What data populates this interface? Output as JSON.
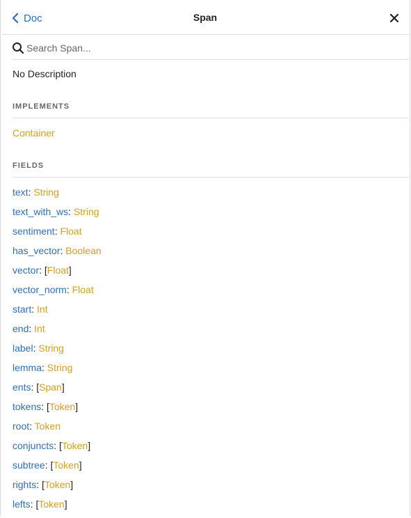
{
  "header": {
    "back_label": "Doc",
    "title": "Span"
  },
  "search": {
    "placeholder": "Search Span..."
  },
  "description": "No Description",
  "implements": {
    "heading": "IMPLEMENTS",
    "items": [
      "Container"
    ]
  },
  "fields": {
    "heading": "FIELDS",
    "items": [
      {
        "name": "text",
        "type": "String",
        "list": false
      },
      {
        "name": "text_with_ws",
        "type": "String",
        "list": false
      },
      {
        "name": "sentiment",
        "type": "Float",
        "list": false
      },
      {
        "name": "has_vector",
        "type": "Boolean",
        "list": false
      },
      {
        "name": "vector",
        "type": "Float",
        "list": true
      },
      {
        "name": "vector_norm",
        "type": "Float",
        "list": false
      },
      {
        "name": "start",
        "type": "Int",
        "list": false
      },
      {
        "name": "end",
        "type": "Int",
        "list": false
      },
      {
        "name": "label",
        "type": "String",
        "list": false
      },
      {
        "name": "lemma",
        "type": "String",
        "list": false
      },
      {
        "name": "ents",
        "type": "Span",
        "list": true
      },
      {
        "name": "tokens",
        "type": "Token",
        "list": true
      },
      {
        "name": "root",
        "type": "Token",
        "list": false
      },
      {
        "name": "conjuncts",
        "type": "Token",
        "list": true
      },
      {
        "name": "subtree",
        "type": "Token",
        "list": true
      },
      {
        "name": "rights",
        "type": "Token",
        "list": true
      },
      {
        "name": "lefts",
        "type": "Token",
        "list": true
      }
    ]
  },
  "colors": {
    "field_name": "#2c6fb7",
    "type_link": "#d4a017",
    "divider": "#e0e0e0"
  },
  "icons": {
    "back": "chevron-left-icon",
    "close": "close-icon",
    "search": "search-icon"
  }
}
